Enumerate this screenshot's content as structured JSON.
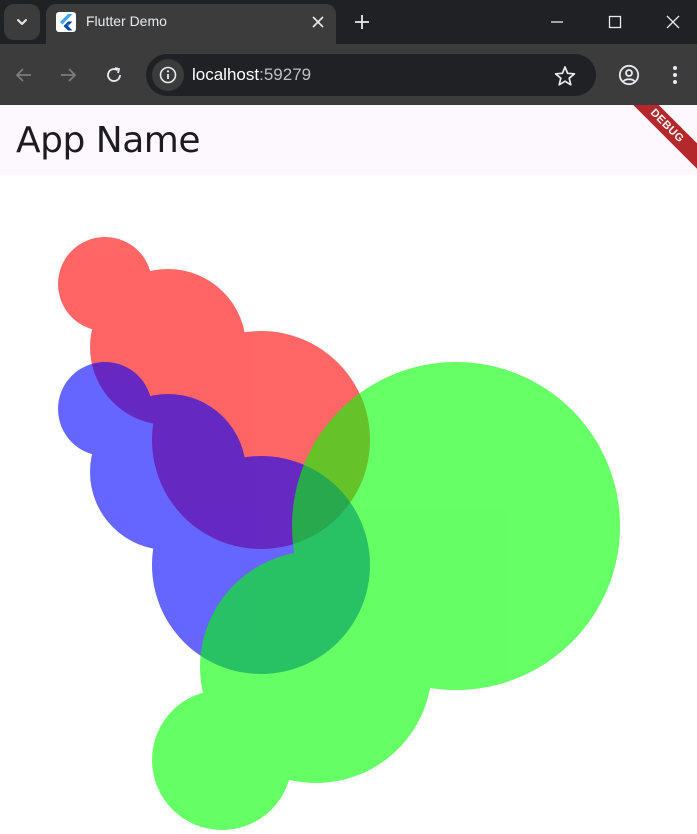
{
  "browser": {
    "tab": {
      "title": "Flutter Demo",
      "favicon": "flutter-logo-icon"
    },
    "omnibox": {
      "host": "localhost",
      "port": ":59279"
    },
    "icons": {
      "tab_search": "chevron-down-icon",
      "tab_close": "close-icon",
      "new_tab": "plus-icon",
      "minimize": "minimize-icon",
      "maximize": "maximize-icon",
      "close_window": "close-icon",
      "back": "arrow-left-icon",
      "forward": "arrow-right-icon",
      "reload": "reload-icon",
      "site_info": "info-icon",
      "bookmark": "star-icon",
      "profile": "profile-icon",
      "menu": "kebab-menu-icon"
    }
  },
  "app": {
    "title": "App Name",
    "debug_banner": "DEBUG",
    "colors": {
      "red": "#ff0000",
      "blue": "#0000ff",
      "green": "#00ff00",
      "appbar_bg": "#fdf7fe"
    }
  }
}
